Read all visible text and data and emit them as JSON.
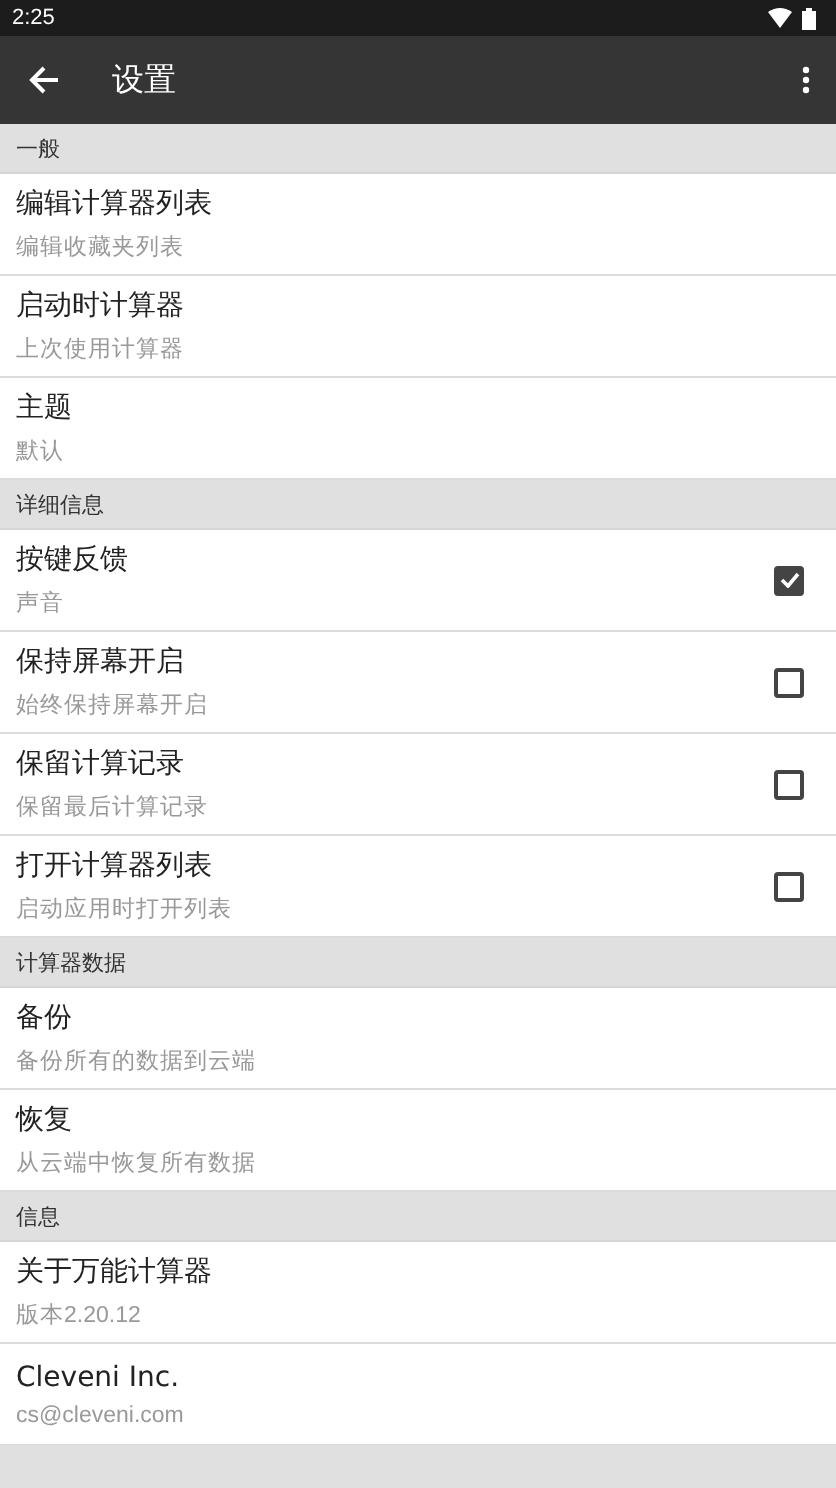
{
  "status_bar": {
    "time": "2:25"
  },
  "app_bar": {
    "title": "设置"
  },
  "sections": [
    {
      "header": "一般",
      "items": [
        {
          "kind": "plain",
          "title": "编辑计算器列表",
          "summary": "编辑收藏夹列表"
        },
        {
          "kind": "plain",
          "title": "启动时计算器",
          "summary": "上次使用计算器"
        },
        {
          "kind": "plain",
          "title": "主题",
          "summary": "默认"
        }
      ]
    },
    {
      "header": "详细信息",
      "items": [
        {
          "kind": "checkbox",
          "title": "按键反馈",
          "summary": "声音",
          "checked": true
        },
        {
          "kind": "checkbox",
          "title": "保持屏幕开启",
          "summary": "始终保持屏幕开启",
          "checked": false
        },
        {
          "kind": "checkbox",
          "title": "保留计算记录",
          "summary": "保留最后计算记录",
          "checked": false
        },
        {
          "kind": "checkbox",
          "title": "打开计算器列表",
          "summary": "启动应用时打开列表",
          "checked": false
        }
      ]
    },
    {
      "header": "计算器数据",
      "items": [
        {
          "kind": "plain",
          "title": "备份",
          "summary": "备份所有的数据到云端"
        },
        {
          "kind": "plain",
          "title": "恢复",
          "summary": "从云端中恢复所有数据"
        }
      ]
    },
    {
      "header": "信息",
      "items": [
        {
          "kind": "plain",
          "title": "关于万能计算器",
          "summary": "版本2.20.12"
        },
        {
          "kind": "plain",
          "title": "Cleveni Inc.",
          "summary": "cs@cleveni.com"
        }
      ]
    }
  ]
}
